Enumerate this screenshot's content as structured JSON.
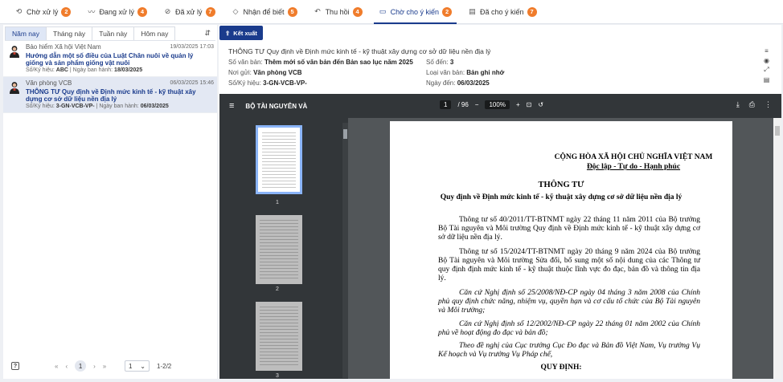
{
  "tabs": [
    {
      "label": "Chờ xử lý",
      "badge": "2",
      "icon": "time-icon"
    },
    {
      "label": "Đang xử lý",
      "badge": "4",
      "icon": "trend-icon"
    },
    {
      "label": "Đã xử lý",
      "badge": "7",
      "icon": "check-circle-icon"
    },
    {
      "label": "Nhận để biết",
      "badge": "5",
      "icon": "tag-icon"
    },
    {
      "label": "Thu hồi",
      "badge": "4",
      "icon": "undo-icon"
    },
    {
      "label": "Chờ cho ý kiến",
      "badge": "2",
      "icon": "comment-icon"
    },
    {
      "label": "Đã cho ý kiến",
      "badge": "7",
      "icon": "message-icon"
    }
  ],
  "period_tabs": [
    "Năm nay",
    "Tháng này",
    "Tuần này",
    "Hôm nay"
  ],
  "list": [
    {
      "org": "Bảo hiểm Xã hội Việt Nam",
      "date": "19/03/2025 17:03",
      "title": "Hướng dẫn một số điều của Luật Chăn nuôi về quản lý giống và sản phẩm giống vật nuôi",
      "code_label": "Số/Ký hiệu:",
      "code": "ABC",
      "issued_label": "Ngày ban hành:",
      "issued": "18/03/2025"
    },
    {
      "org": "Văn phòng VCB",
      "date": "06/03/2025 15:46",
      "title": "THÔNG TƯ Quy định về Định mức kinh tế - kỹ thuật xây dựng cơ sở dữ liệu nền địa lý",
      "code_label": "Số/Ký hiệu:",
      "code": "3-GN-VCB-VP-",
      "issued_label": "Ngày ban hành:",
      "issued": "06/03/2025"
    }
  ],
  "pager": {
    "page": "1",
    "size": "1",
    "count": "1-2/2"
  },
  "export_label": "Kết xuất",
  "doc": {
    "title": "THÔNG TƯ Quy định về Định mức kinh tế - kỹ thuật xây dựng cơ sở dữ liệu nền địa lý",
    "so_van_ban_label": "Số văn bản:",
    "so_van_ban": "Thêm mới số văn bản đến Bản sao lục năm 2025",
    "so_den_label": "Số đến:",
    "so_den": "3",
    "noi_gui_label": "Nơi gửi:",
    "noi_gui": "Văn phòng VCB",
    "loai_label": "Loại văn bản:",
    "loai": "Bản ghi nhớ",
    "ky_hieu_label": "Số/Ký hiệu:",
    "ky_hieu": "3-GN-VCB-VP-",
    "ngay_den_label": "Ngày đến:",
    "ngay_den": "06/03/2025"
  },
  "viewer": {
    "filename": "BỘ TÀI NGUYÊN VÀ",
    "page": "1",
    "total": "/ 96",
    "zoom": "100%",
    "thumb_labels": [
      "1",
      "2",
      "3"
    ],
    "page_text": {
      "republic": "CỘNG HÒA XÃ HỘI CHỦ NGHĨA VIỆT NAM",
      "motto": "Độc lập - Tự do - Hạnh phúc",
      "doc_type": "THÔNG TƯ",
      "subject": "Quy định về Định mức kinh tế - kỹ thuật xây dựng cơ sở dữ liệu nền địa lý",
      "p1": "Thông tư số 40/2011/TT-BTNMT ngày 22 tháng 11 năm 2011 của Bộ trưởng Bộ Tài nguyên và Môi trường Quy định về Định mức kinh tế - kỹ thuật xây dựng cơ sở dữ liệu nền địa lý.",
      "p2": "Thông tư số 15/2024/TT-BTNMT ngày 20 tháng 9 năm 2024 của Bộ trưởng Bộ Tài nguyên và Môi trường Sửa đổi, bổ sung một số nội dung của các Thông tư quy định định mức kinh tế - kỹ thuật thuộc lĩnh vực đo đạc, bản đồ và thông tin địa lý.",
      "p3": "Căn cứ Nghị định số 25/2008/NĐ-CP ngày 04 tháng 3 năm 2008 của Chính phủ quy định chức năng, nhiệm vụ, quyền hạn và cơ cấu tổ chức của Bộ Tài nguyên và Môi trường;",
      "p4": "Căn cứ Nghị định số 12/2002/NĐ-CP ngày 22 tháng 01 năm 2002 của Chính phủ về hoạt động đo đạc và bản đồ;",
      "p5": "Theo đề nghị của Cục trưởng Cục Đo đạc và Bản đồ Việt Nam, Vụ trưởng Vụ Kế hoạch và Vụ trưởng Vụ Pháp chế,",
      "heading": "QUY ĐỊNH:"
    }
  }
}
